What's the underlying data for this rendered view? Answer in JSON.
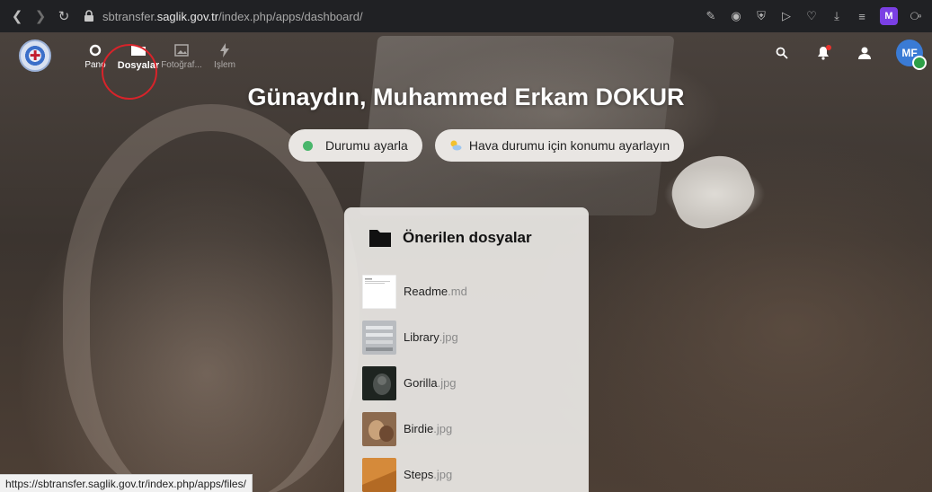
{
  "browser": {
    "url_prefix": "sbtransfer.",
    "url_host": "saglik.gov.tr",
    "url_path": "/index.php/apps/dashboard/",
    "profile_initial": "M"
  },
  "appbar": {
    "logo_mark": "✚",
    "apps": [
      {
        "label": "Pano"
      },
      {
        "label": "Dosyalar"
      },
      {
        "label": "Fotoğraf..."
      },
      {
        "label": "İşlem"
      }
    ],
    "avatar_initials": "MF"
  },
  "dashboard": {
    "greeting": "Günaydın, Muhammed Erkam DOKUR",
    "status_button": "Durumu ayarla",
    "weather_button": "Hava durumu için konumu ayarlayın"
  },
  "recommended": {
    "title": "Önerilen dosyalar",
    "files": [
      {
        "name": "Readme",
        "ext": ".md"
      },
      {
        "name": "Library",
        "ext": ".jpg"
      },
      {
        "name": "Gorilla",
        "ext": ".jpg"
      },
      {
        "name": "Birdie",
        "ext": ".jpg"
      },
      {
        "name": "Steps",
        "ext": ".jpg"
      }
    ]
  },
  "statusbar": {
    "link": "https://sbtransfer.saglik.gov.tr/index.php/apps/files/"
  },
  "colors": {
    "highlight_circle": "#d8232a",
    "status_online": "#49b66b",
    "avatar_bg": "#3a7bd5"
  }
}
